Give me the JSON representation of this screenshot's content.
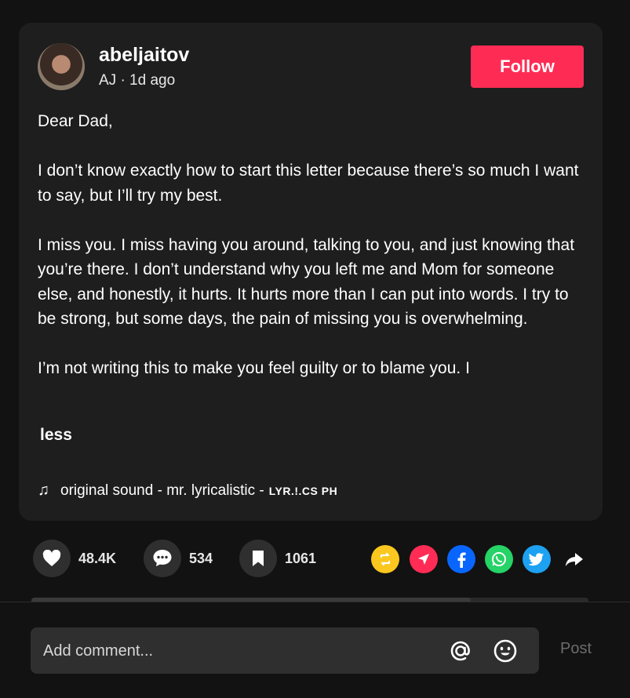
{
  "post": {
    "username": "abeljaitov",
    "meta": "AJ · 1d ago",
    "follow_label": "Follow",
    "caption": [
      "Dear Dad,",
      "I don’t know exactly how to start this letter because there’s so much I want to say, but I’ll try my best.",
      "I miss you. I miss having you around, talking to you, and just knowing that you’re there. I don’t understand why you left me and Mom for someone else, and honestly, it hurts. It hurts more than I can put into words. I try to be strong, but some days, the pain of missing you is overwhelming.",
      "I’m not writing this to make you feel guilty or to blame you. I"
    ],
    "less_label": "less",
    "sound": {
      "text": "original sound - mr. lyricalistic -",
      "smallcaps": "LYR.!.CS PH",
      "icon": "music-note-icon"
    }
  },
  "actions": {
    "likes": "48.4K",
    "comments": "534",
    "saves": "1061",
    "share_icons": [
      "repost-icon",
      "send-icon",
      "facebook-icon",
      "whatsapp-icon",
      "twitter-icon",
      "share-arrow-icon"
    ]
  },
  "comment": {
    "placeholder": "Add comment...",
    "post_label": "Post"
  },
  "colors": {
    "accent": "#fe2c55",
    "background": "#121212",
    "card": "#1e1e1e"
  }
}
